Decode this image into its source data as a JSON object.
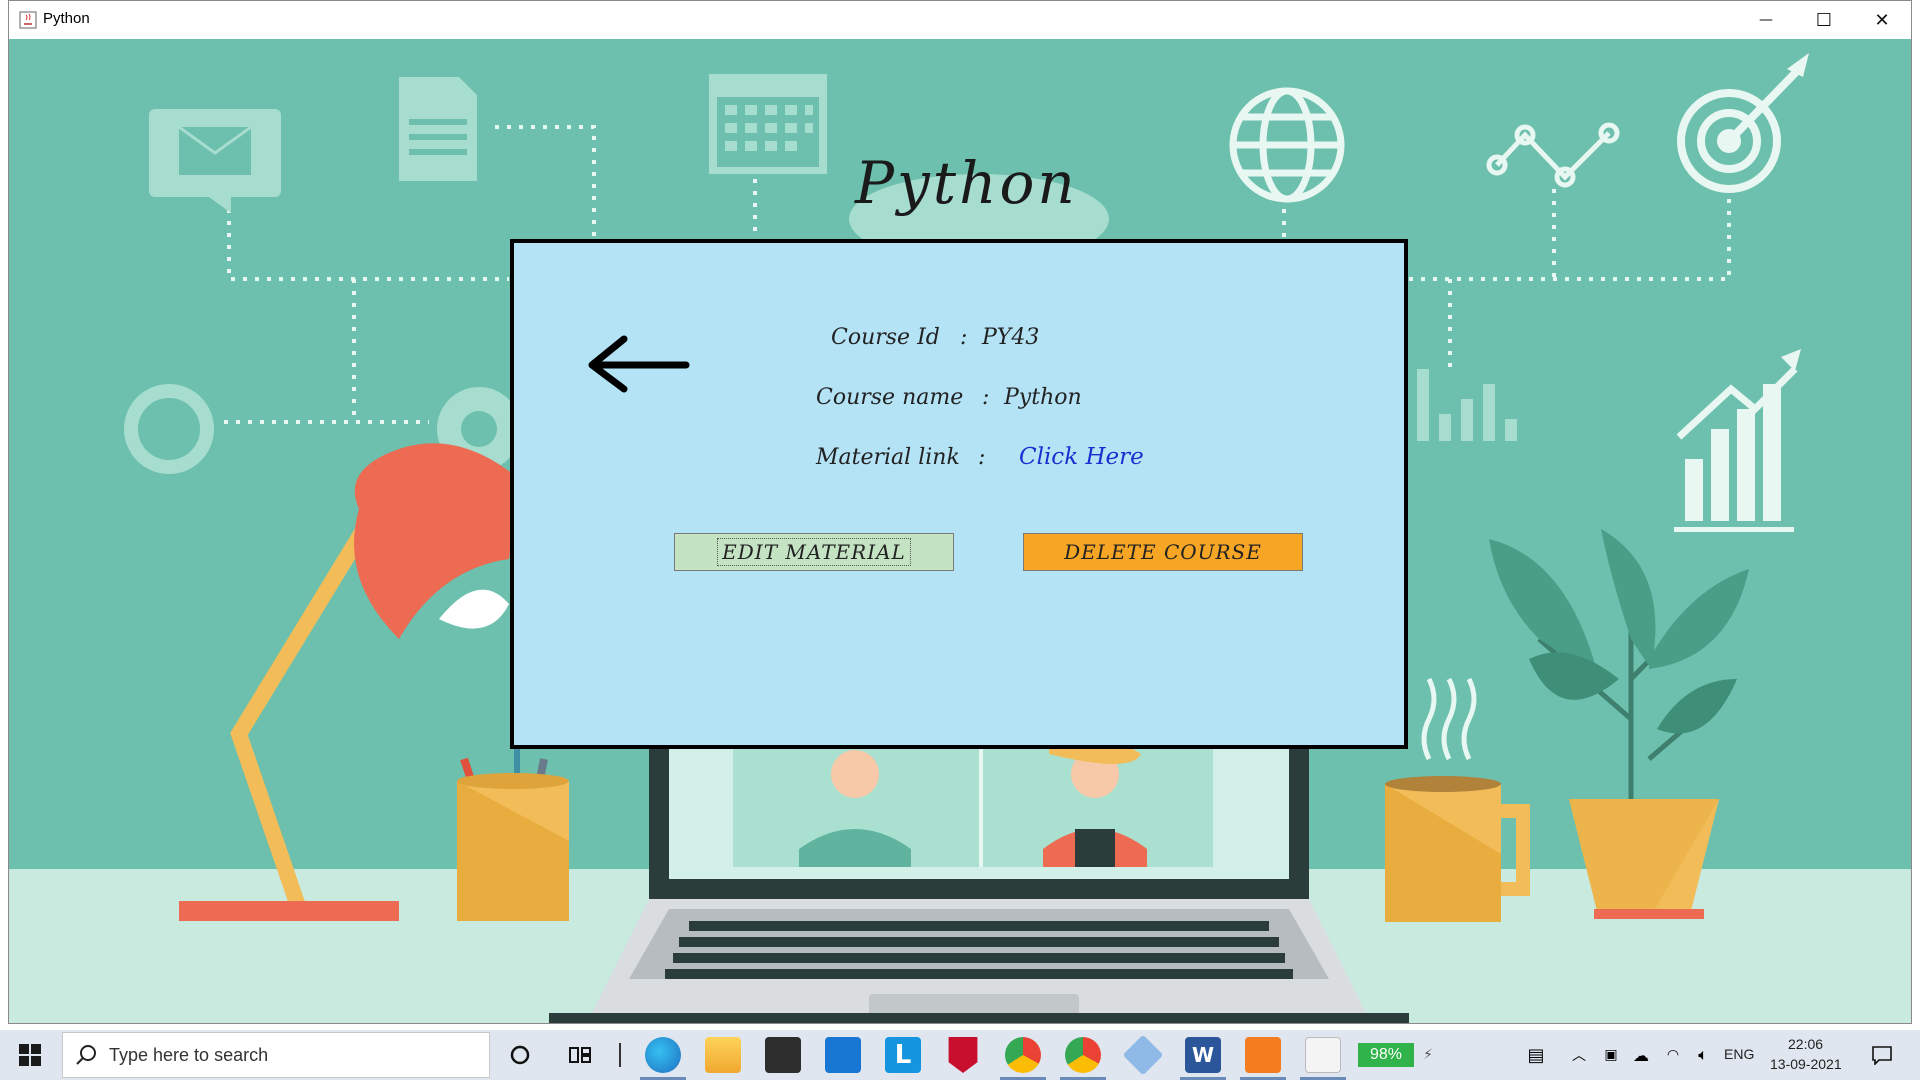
{
  "window": {
    "title": "Python",
    "minimize_glyph": "—",
    "maximize_glyph": "☐",
    "close_glyph": "✕"
  },
  "page": {
    "heading": "Python"
  },
  "course": {
    "id_label": "Course Id",
    "id_sep": ":",
    "id_value": "PY43",
    "name_label": "Course name",
    "name_sep": ":",
    "name_value": "Python",
    "material_label": "Material link",
    "material_sep": ":",
    "material_link": "Click Here"
  },
  "buttons": {
    "edit_material": "EDIT MATERIAL",
    "delete_course": "DELETE COURSE"
  },
  "colors": {
    "background": "#6cc0ad",
    "panel": "#b4e3f6",
    "edit_button": "#c3e3c3",
    "delete_button": "#f6a524",
    "link": "#1a2fd0"
  },
  "taskbar": {
    "search_placeholder": "Type here to search",
    "battery": "98%",
    "language": "ENG",
    "time": "22:06",
    "date": "13-09-2021",
    "apps": [
      "cortana-icon",
      "task-view-icon",
      "edge-icon",
      "file-explorer-icon",
      "store-icon",
      "mail-icon",
      "l-app-icon",
      "mcafee-icon",
      "chrome-icon",
      "chrome-profile-icon",
      "virtualbox-icon",
      "word-icon",
      "xampp-icon",
      "java-icon"
    ]
  }
}
